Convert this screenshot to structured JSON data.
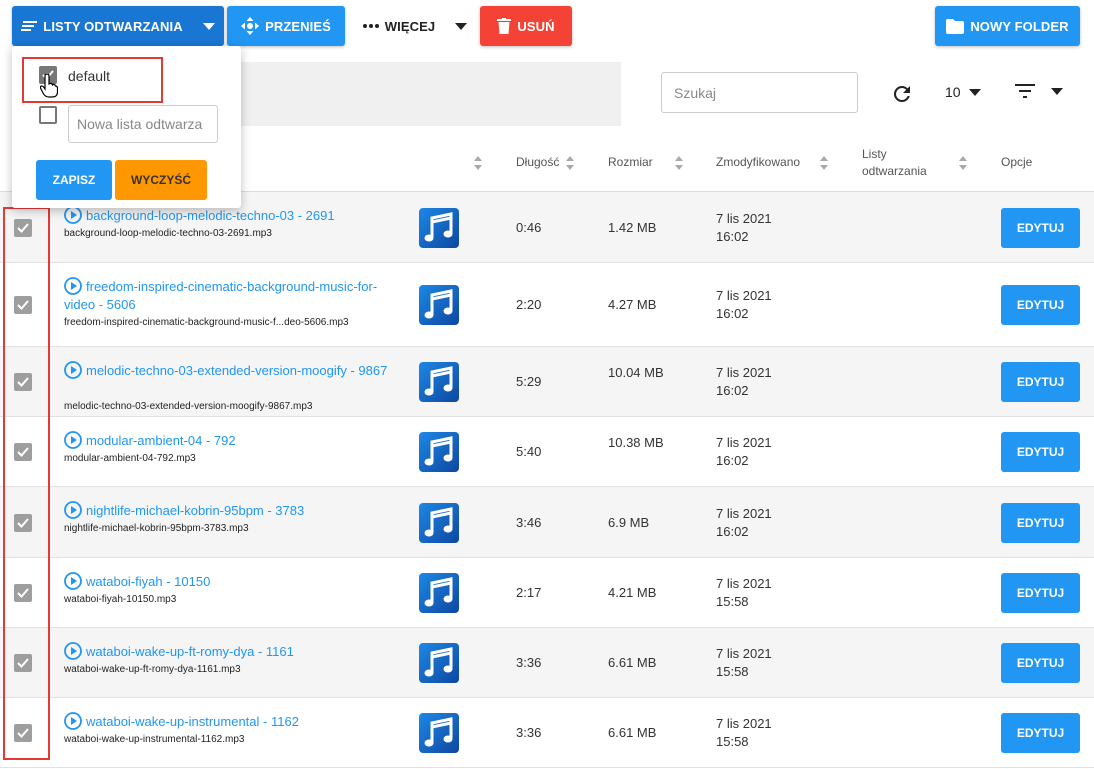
{
  "toolbar": {
    "playlists_label": "LISTY ODTWARZANIA",
    "move_label": "PRZENIEŚ",
    "more_label": "WIĘCEJ",
    "delete_label": "USUŃ",
    "new_folder_label": "NOWY FOLDER"
  },
  "search": {
    "placeholder": "Szukaj"
  },
  "per_page": "10",
  "columns": {
    "duration": "Długość",
    "size": "Rozmiar",
    "modified": "Zmodyfikowano",
    "playlists": "Listy odtwarzania",
    "options": "Opcje"
  },
  "dropdown": {
    "playlist_name": "default",
    "new_list_placeholder": "Nowa lista odtwarza",
    "save_label": "ZAPISZ",
    "clear_label": "WYCZYŚĆ"
  },
  "edit_label": "EDYTUJ",
  "rows": [
    {
      "title": "background-loop-melodic-techno-03 - 2691",
      "file": "background-loop-melodic-techno-03-2691.mp3",
      "duration": "0:46",
      "size": "1.42 MB",
      "date": "7 lis 2021",
      "time": "16:02"
    },
    {
      "title": "freedom-inspired-cinematic-background-music-for-video - 5606",
      "file": "freedom-inspired-cinematic-background-music-f...deo-5606.mp3",
      "duration": "2:20",
      "size": "4.27 MB",
      "date": "7 lis 2021",
      "time": "16:02"
    },
    {
      "title": "melodic-techno-03-extended-version-moogify - 9867",
      "file": "melodic-techno-03-extended-version-moogify-9867.mp3",
      "duration": "5:29",
      "size": "10.04 MB",
      "date": "7 lis 2021",
      "time": "16:02"
    },
    {
      "title": "modular-ambient-04 - 792",
      "file": "modular-ambient-04-792.mp3",
      "duration": "5:40",
      "size": "10.38 MB",
      "date": "7 lis 2021",
      "time": "16:02"
    },
    {
      "title": "nightlife-michael-kobrin-95bpm - 3783",
      "file": "nightlife-michael-kobrin-95bpm-3783.mp3",
      "duration": "3:46",
      "size": "6.9 MB",
      "date": "7 lis 2021",
      "time": "16:02"
    },
    {
      "title": "wataboi-fiyah - 10150",
      "file": "wataboi-fiyah-10150.mp3",
      "duration": "2:17",
      "size": "4.21 MB",
      "date": "7 lis 2021",
      "time": "15:58"
    },
    {
      "title": "wataboi-wake-up-ft-romy-dya - 1161",
      "file": "wataboi-wake-up-ft-romy-dya-1161.mp3",
      "duration": "3:36",
      "size": "6.61 MB",
      "date": "7 lis 2021",
      "time": "15:58"
    },
    {
      "title": "wataboi-wake-up-instrumental - 1162",
      "file": "wataboi-wake-up-instrumental-1162.mp3",
      "duration": "3:36",
      "size": "6.61 MB",
      "date": "7 lis 2021",
      "time": "15:58"
    }
  ]
}
